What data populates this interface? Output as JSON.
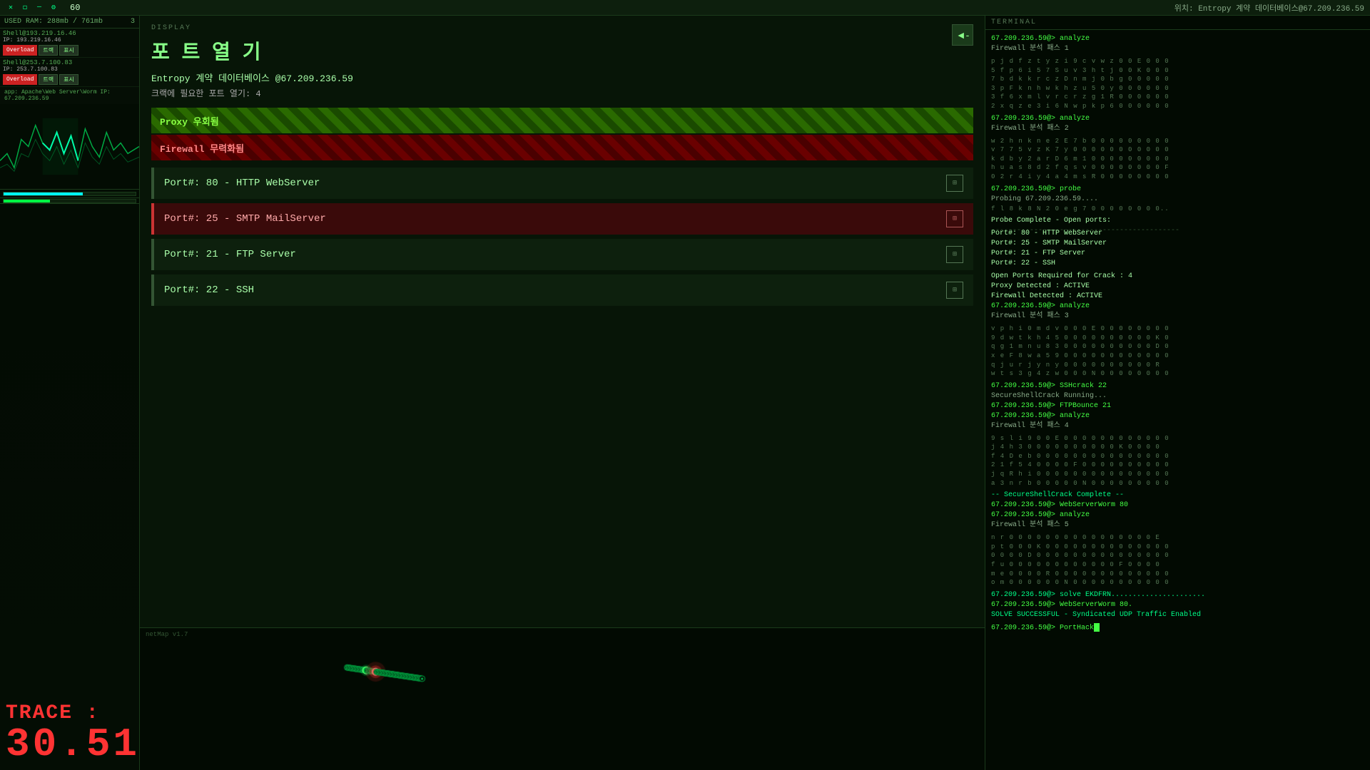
{
  "topbar": {
    "icons": [
      "✕",
      "◻",
      "—",
      "⚙"
    ],
    "number": "60",
    "status_text": "위치: Entropy 계약 데이터베이스@67.209.236.59"
  },
  "left_panel": {
    "ram_label": "RAM",
    "ram_used": "USED RAM: 288mb / 761mb",
    "ram_num": "3",
    "shells": [
      {
        "ip": "Shell@193.219.16.46",
        "ip2": "IP: 193.219.16.46",
        "buttons": [
          "Overload",
          "트랙",
          "표시"
        ]
      },
      {
        "ip": "Shell@253.7.100.83",
        "ip2": "IP: 253.7.100.83",
        "buttons": [
          "Overload",
          "트랙",
          "표시"
        ]
      }
    ],
    "app_info": "app: Apache\\Web Server\\Worm IP: 67.209.236.59",
    "trace_label": "TRACE :",
    "trace_value": "30.51"
  },
  "display": {
    "section_label": "DISPLAY",
    "port_title": "포 트  열 기",
    "target": "Entropy 계약 데이터베이스 @67.209.236.59",
    "crack_info": "크랙에 필요한 포트 열기: 4",
    "back_btn": "◄-",
    "proxy_banner": "Proxy 우회됨",
    "firewall_banner": "Firewall 무력화됨",
    "ports": [
      {
        "num": "80",
        "service": "HTTP WebServer",
        "selected": false
      },
      {
        "num": "25",
        "service": "SMTP MailServer",
        "selected": true
      },
      {
        "num": "21",
        "service": "FTP Server",
        "selected": false
      },
      {
        "num": "22",
        "service": "SSH",
        "selected": false
      }
    ]
  },
  "netmap": {
    "label": "netMap v1.7"
  },
  "terminal": {
    "label": "TERMINAL",
    "header_status": "위치: Entropy 계약 데이터베이스@67.209.236.59",
    "lines": [
      {
        "type": "prompt",
        "text": "67.209.236.59@> analyze"
      },
      {
        "type": "text",
        "text": "Firewall 분석 패스 1"
      },
      {
        "type": "separator",
        "text": ""
      },
      {
        "type": "data",
        "text": "p j d f z t y z i 9 c v w z 0 0 E 0 0 0"
      },
      {
        "type": "data",
        "text": "5 f p 6 i 5 7 S u v 3 h t j 0 0 K 0 0 0"
      },
      {
        "type": "data",
        "text": "7 b d k k r c z D n m j 0 b g 0 0 0 0 0"
      },
      {
        "type": "data",
        "text": "3 p F k n h w k h z u 5 0 y 0 0 0 0 0 0"
      },
      {
        "type": "data",
        "text": "3 f 6 x m l v r c r z g 1 R 0 0 0 0 0 0"
      },
      {
        "type": "data",
        "text": "2 x q z e 3 i 6 N w p k p 6 0 0 0 0 0 0"
      },
      {
        "type": "separator",
        "text": ""
      },
      {
        "type": "prompt",
        "text": "67.209.236.59@> analyze"
      },
      {
        "type": "text",
        "text": "Firewall 분석 패스 2"
      },
      {
        "type": "separator",
        "text": ""
      },
      {
        "type": "data",
        "text": "w 2 h n k n e 2 E 7 b 0 0 0 0 0 0 0 0 0"
      },
      {
        "type": "data",
        "text": "v 7 7 5 v z K 7 y 0 0 0 0 0 0 0 0 0 0 0"
      },
      {
        "type": "data",
        "text": "k d b y 2 a r D 6 m 1 0 0 0 0 0 0 0 0 0"
      },
      {
        "type": "data",
        "text": "h u a s 8 d 2 f q s v 0 0 0 0 0 0 0 0 F"
      },
      {
        "type": "data",
        "text": "0 2 r 4 i y 4 a 4 m s R 0 0 0 0 0 0 0 0"
      },
      {
        "type": "separator",
        "text": ""
      },
      {
        "type": "prompt",
        "text": "67.209.236.59@> probe"
      },
      {
        "type": "text",
        "text": "Probing 67.209.236.59...."
      },
      {
        "type": "data",
        "text": "f l 8 k 8 N 2 0 e g 7 0 0 0 0 0 0 0 0.."
      },
      {
        "type": "separator",
        "text": ""
      },
      {
        "type": "highlight",
        "text": "Probe Complete - Open ports:"
      },
      {
        "type": "separator",
        "text": "--------------------------------------------"
      },
      {
        "type": "highlight",
        "text": "Port#: 80  -  HTTP WebServer"
      },
      {
        "type": "highlight",
        "text": "Port#: 25  -  SMTP MailServer"
      },
      {
        "type": "highlight",
        "text": "Port#: 21  -  FTP Server"
      },
      {
        "type": "highlight",
        "text": "Port#: 22  -  SSH"
      },
      {
        "type": "separator",
        "text": ""
      },
      {
        "type": "highlight",
        "text": "Open Ports Required for Crack : 4"
      },
      {
        "type": "highlight",
        "text": "Proxy Detected : ACTIVE"
      },
      {
        "type": "highlight",
        "text": "Firewall Detected : ACTIVE"
      },
      {
        "type": "prompt",
        "text": "67.209.236.59@> analyze"
      },
      {
        "type": "text",
        "text": "Firewall 분석 패스 3"
      },
      {
        "type": "separator",
        "text": ""
      },
      {
        "type": "data",
        "text": "v p h i 0 m d v 0 0 0 E 0 0 0 0 0 0 0 0"
      },
      {
        "type": "data",
        "text": "9 d w t k h 4 5 0 0 0 0 0 0 0 0 0 0 K 0"
      },
      {
        "type": "data",
        "text": "q g 1 m n u 8 3 0 0 0 0 0 0 0 0 0 0 D 0"
      },
      {
        "type": "data",
        "text": "x e F 8 w a 5 9 0 0 0 0 0 0 0 0 0 0 0 0"
      },
      {
        "type": "data",
        "text": "q j u r j y n y 0 0 0 0 0 0 0 0 0 0 R"
      },
      {
        "type": "data",
        "text": "w t s 3 g 4 z w 0 0 0 N 0 0 0 0 0 0 0 0"
      },
      {
        "type": "separator",
        "text": ""
      },
      {
        "type": "prompt",
        "text": "67.209.236.59@> SSHcrack 22"
      },
      {
        "type": "text",
        "text": "SecureShellCrack Running..."
      },
      {
        "type": "prompt",
        "text": "67.209.236.59@> FTPBounce 21"
      },
      {
        "type": "prompt",
        "text": "67.209.236.59@> analyze"
      },
      {
        "type": "text",
        "text": "Firewall 분석 패스 4"
      },
      {
        "type": "separator",
        "text": ""
      },
      {
        "type": "data",
        "text": "9 s l i 9 0 0 E 0 0 0 0 0 0 0 0 0 0 0 0"
      },
      {
        "type": "data",
        "text": "j 4 h 3 0 0 0 0 0 0 0 0 0 0 K 0 0 0 0"
      },
      {
        "type": "data",
        "text": "f 4 D e b 0 0 0 0 0 0 0 0 0 0 0 0 0 0 0"
      },
      {
        "type": "data",
        "text": "2 1 f 5 4 0 0 0 0 F 0 0 0 0 0 0 0 0 0 0"
      },
      {
        "type": "data",
        "text": "j q R h i 0 0 0 0 0 0 0 0 0 0 0 0 0 0 0"
      },
      {
        "type": "data",
        "text": "a 3 n r b 0 0 0 0 0 N 0 0 0 0 0 0 0 0 0"
      },
      {
        "type": "separator",
        "text": ""
      },
      {
        "type": "success",
        "text": "-- SecureShellCrack Complete --"
      },
      {
        "type": "prompt",
        "text": "67.209.236.59@> WebServerWorm 80"
      },
      {
        "type": "prompt",
        "text": "67.209.236.59@> analyze"
      },
      {
        "type": "text",
        "text": "Firewall 분석 패스 5"
      },
      {
        "type": "separator",
        "text": ""
      },
      {
        "type": "data",
        "text": "n r 0 0 0 0 0 0 0 0 0 0 0 0 0 0 0 0 E"
      },
      {
        "type": "data",
        "text": "p t 0 0 0 K 0 0 0 0 0 0 0 0 0 0 0 0 0 0"
      },
      {
        "type": "data",
        "text": "0 0 0 0 D 0 0 0 0 0 0 0 0 0 0 0 0 0 0 0"
      },
      {
        "type": "data",
        "text": "f u 0 0 0 0 0 0 0 0 0 0 0 0 F 0 0 0 0"
      },
      {
        "type": "data",
        "text": "m e 0 0 0 0 R 0 0 0 0 0 0 0 0 0 0 0 0 0"
      },
      {
        "type": "data",
        "text": "o m 0 0 0 0 0 0 N 0 0 0 0 0 0 0 0 0 0 0"
      },
      {
        "type": "separator",
        "text": ""
      },
      {
        "type": "success",
        "text": "67.209.236.59@> solve EKDFRN......................"
      },
      {
        "type": "prompt",
        "text": "67.209.236.59@> WebServerWorm 80."
      },
      {
        "type": "success",
        "text": "SOLVE SUCCESSFUL - Syndicated UDP Traffic Enabled"
      },
      {
        "type": "separator",
        "text": ""
      },
      {
        "type": "prompt_active",
        "text": "67.209.236.59@> PortHack"
      }
    ]
  }
}
